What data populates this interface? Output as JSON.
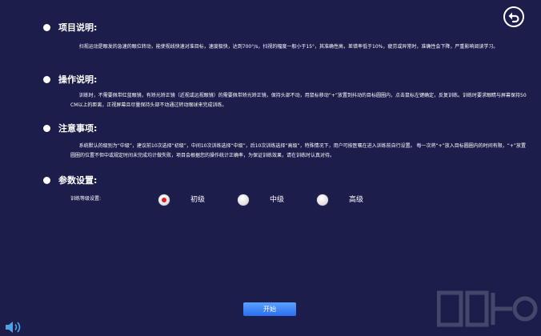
{
  "sections": [
    {
      "title": "项目说明:",
      "body": "扫视运动是眼发的急速的眼位转动，能使视线快速对准目标，速度极快，达到700°/s，扫视的幅度一般小于15°，其准确性高，差错率低于10%，疲劳或异常时，准确性会下降，严重影响阅读学习。"
    },
    {
      "title": "操作说明:",
      "body": "训练时，不需要佩带红蓝眼镜，有矫光矫正镜（近视或远视眼镜）的需要佩带矫光矫正镜，保持头部不动，用鼠标移动“+”放置到抖动的目标圆圈内，点击鼠标左键确定，反复训练。训练时要求眼睛与屏幕保持50CM以上的距离，正视屏幕且尽量保持头部不动通过转动眼球来完成训练。"
    },
    {
      "title": "注意事项:",
      "body": "系统默认的级别为“中级”，建议前10次选择“初级”，中间10次训练选择“中级”，后10次训练选择“高级”，特殊情况下，用户可按医嘱在进入训练前自行设置。 每一次将“+”放入目标圆圈内的时间有限，“+”放置圆圈的位置不但中或规定时间未完成均计做失败，项目会根据您的操作统计正确率，为保证训练效果，请在训练时认真对待。"
    },
    {
      "title": "参数设置:"
    }
  ],
  "params": {
    "level_label": "训练等级设置:",
    "options": [
      "初级",
      "中级",
      "高级"
    ],
    "selected": "初级"
  },
  "start_button_label": "开始",
  "colors": {
    "background": "#1c1d4a",
    "accent": "#2b6ef0",
    "radio_selected": "#e21b2b"
  },
  "icons": {
    "back": "back-arrow-icon",
    "speaker": "speaker-icon"
  }
}
